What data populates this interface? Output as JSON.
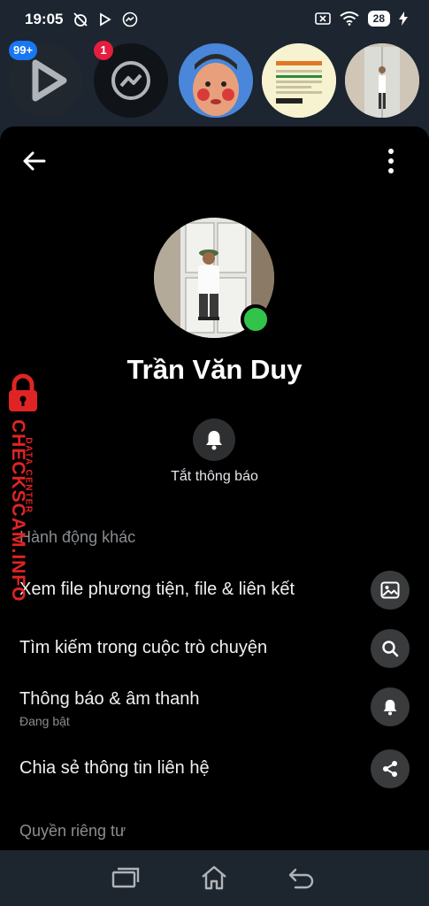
{
  "status_bar": {
    "time": "19:05",
    "battery": "28",
    "icons": [
      "alarm-off-icon",
      "play-icon",
      "messenger-icon",
      "screen-cast-icon",
      "wifi-icon",
      "battery-icon",
      "charging-icon"
    ]
  },
  "chat_heads": [
    {
      "name": "video-app-head",
      "badge": "99+",
      "badge_color": "#1877f2"
    },
    {
      "name": "messenger-head",
      "badge": "1",
      "badge_color": "#e41e3f"
    },
    {
      "name": "contact-head-1",
      "badge": ""
    },
    {
      "name": "contact-head-2",
      "badge": ""
    },
    {
      "name": "contact-head-3",
      "badge": ""
    }
  ],
  "profile": {
    "name": "Trần Văn Duy",
    "online": true,
    "mute_label": "Tắt thông báo"
  },
  "sections": {
    "more_actions": "Hành động khác",
    "privacy": "Quyền riêng tư"
  },
  "actions": [
    {
      "label": "Xem file phương tiện, file & liên kết",
      "sub": "",
      "icon": "image-icon"
    },
    {
      "label": "Tìm kiếm trong cuộc trò chuyện",
      "sub": "",
      "icon": "search-icon"
    },
    {
      "label": "Thông báo & âm thanh",
      "sub": "Đang bật",
      "icon": "bell-icon"
    },
    {
      "label": "Chia sẻ thông tin liên hệ",
      "sub": "",
      "icon": "share-icon"
    }
  ],
  "watermark": {
    "main": "CHECKSCAM.INFO",
    "sub": "DATA CENTER"
  },
  "colors": {
    "accent_blue": "#1877f2",
    "online_green": "#31c34a",
    "watermark_red": "#e02424"
  }
}
